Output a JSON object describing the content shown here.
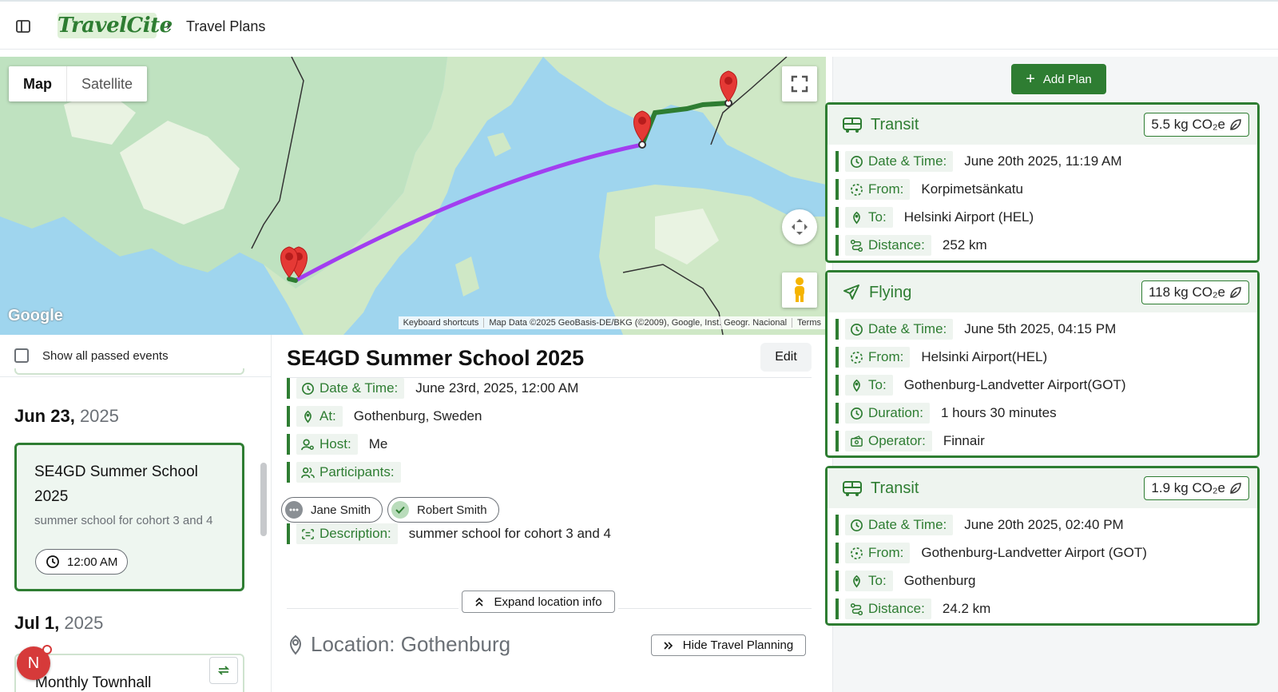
{
  "header": {
    "app_name": "TravelCite",
    "breadcrumb_sep": "›",
    "breadcrumb": "Travel Plans"
  },
  "map": {
    "tabs": [
      "Map",
      "Satellite"
    ],
    "active_tab": "Map",
    "google_logo": "Google",
    "attribution": [
      "Keyboard shortcuts",
      "Map Data ©2025 GeoBasis-DE/BKG (©2009), Google, Inst. Geogr. Nacional",
      "Terms"
    ],
    "route_color_flight": "#a23ef0",
    "route_color_transit": "#2e7d32"
  },
  "list": {
    "show_passed_label": "Show all passed events",
    "groups": [
      {
        "date": "Jun 23,",
        "year": "2025",
        "event": {
          "title": "SE4GD Summer School 2025",
          "description": "summer school for cohort 3 and 4",
          "time": "12:00 AM"
        }
      },
      {
        "date": "Jul 1,",
        "year": "2025",
        "event": {
          "title": "Monthly Townhall"
        }
      }
    ],
    "avatar_initial": "N"
  },
  "detail": {
    "title": "SE4GD Summer School 2025",
    "edit_label": "Edit",
    "fields": {
      "datetime_label": "Date & Time:",
      "datetime": "June 23rd, 2025, 12:00 AM",
      "at_label": "At:",
      "at": "Gothenburg, Sweden",
      "host_label": "Host:",
      "host": "Me",
      "participants_label": "Participants:",
      "description_label": "Description:",
      "description": "summer school for cohort 3 and 4"
    },
    "participants": [
      {
        "name": "Jane Smith",
        "status": "pending"
      },
      {
        "name": "Robert Smith",
        "status": "accepted"
      }
    ],
    "expand_label": "Expand location info",
    "location": "Location: Gothenburg",
    "hide_label": "Hide Travel Planning"
  },
  "plans": {
    "add_label": "Add Plan",
    "cards": [
      {
        "type": "Transit",
        "co2": "5.5 kg CO₂e",
        "rows": [
          {
            "label": "Date & Time:",
            "value": "June 20th 2025, 11:19 AM"
          },
          {
            "label": "From:",
            "value": "Korpimetsänkatu"
          },
          {
            "label": "To:",
            "value": "Helsinki Airport (HEL)"
          },
          {
            "label": "Distance:",
            "value": "252 km"
          }
        ]
      },
      {
        "type": "Flying",
        "co2": "118 kg CO₂e",
        "rows": [
          {
            "label": "Date & Time:",
            "value": "June 5th 2025, 04:15 PM"
          },
          {
            "label": "From:",
            "value": "Helsinki Airport(HEL)"
          },
          {
            "label": "To:",
            "value": "Gothenburg-Landvetter Airport(GOT)"
          },
          {
            "label": "Duration:",
            "value": "1 hours 30 minutes"
          },
          {
            "label": "Operator:",
            "value": "Finnair"
          }
        ]
      },
      {
        "type": "Transit",
        "co2": "1.9 kg CO₂e",
        "rows": [
          {
            "label": "Date & Time:",
            "value": "June 20th 2025, 02:40 PM"
          },
          {
            "label": "From:",
            "value": "Gothenburg-Landvetter Airport (GOT)"
          },
          {
            "label": "To:",
            "value": "Gothenburg"
          },
          {
            "label": "Distance:",
            "value": "24.2 km"
          }
        ]
      }
    ]
  },
  "colors": {
    "accent": "#2e7d32",
    "accent_light": "#eef4ef",
    "flight_route": "#a23ef0",
    "marker": "#e53935"
  }
}
